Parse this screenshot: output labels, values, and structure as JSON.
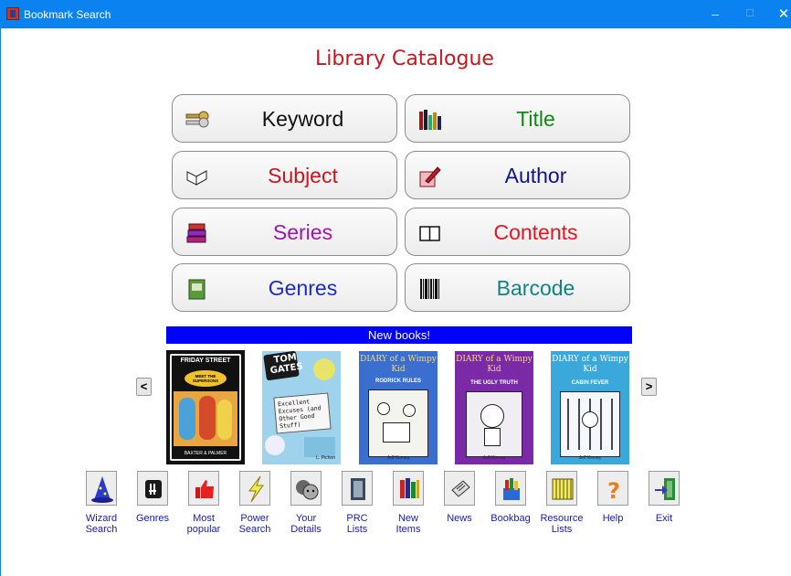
{
  "window": {
    "title": "Bookmark Search",
    "minimize": "–",
    "maximize": "☐",
    "close": "✕"
  },
  "heading": "Library Catalogue",
  "search_buttons": [
    {
      "label": "Keyword",
      "color": "#111111",
      "icon": "key-icon"
    },
    {
      "label": "Title",
      "color": "#118811",
      "icon": "books-shelf-icon"
    },
    {
      "label": "Subject",
      "color": "#c8161e",
      "icon": "open-book-icon"
    },
    {
      "label": "Author",
      "color": "#12128a",
      "icon": "pen-writing-icon"
    },
    {
      "label": "Series",
      "color": "#a412b0",
      "icon": "stacked-books-icon"
    },
    {
      "label": "Contents",
      "color": "#e5161e",
      "icon": "contents-book-icon"
    },
    {
      "label": "Genres",
      "color": "#1a2ad0",
      "icon": "green-book-icon"
    },
    {
      "label": "Barcode",
      "color": "#0f8580",
      "icon": "barcode-icon"
    }
  ],
  "new_books": {
    "title": "New books!",
    "prev": "<",
    "next": ">",
    "books": [
      {
        "title": "FRIDAY STREET",
        "sub": "MEET THE SUPERSONS",
        "author": "BAXTER & PALMER"
      },
      {
        "title": "TOM GATES",
        "sub": "Excellent Excuses (and Other Good Stuff)",
        "author": "L. Pichon"
      },
      {
        "title": "DIARY of a Wimpy Kid",
        "sub": "RODRICK RULES",
        "author": "Jeff Kinney"
      },
      {
        "title": "DIARY of a Wimpy Kid",
        "sub": "THE UGLY TRUTH",
        "author": "Jeff Kinney"
      },
      {
        "title": "DIARY of a Wimpy Kid",
        "sub": "CABIN FEVER",
        "author": "Jeff Kinney"
      }
    ]
  },
  "toolbar": [
    {
      "label": "Wizard\nSearch",
      "icon": "wizard-hat-icon"
    },
    {
      "label": "Genres",
      "icon": "genres-icon"
    },
    {
      "label": "Most\npopular",
      "icon": "thumbs-up-icon"
    },
    {
      "label": "Power\nSearch",
      "icon": "lightning-icon"
    },
    {
      "label": "Your\nDetails",
      "icon": "faces-icon"
    },
    {
      "label": "PRC\nLists",
      "icon": "book-list-icon"
    },
    {
      "label": "New\nItems",
      "icon": "new-books-icon"
    },
    {
      "label": "News",
      "icon": "newspaper-icon"
    },
    {
      "label": "Bookbag",
      "icon": "bookbag-icon"
    },
    {
      "label": "Resource\nLists",
      "icon": "resource-shelf-icon"
    },
    {
      "label": "Help",
      "icon": "question-icon"
    },
    {
      "label": "Exit",
      "icon": "exit-door-icon"
    }
  ]
}
